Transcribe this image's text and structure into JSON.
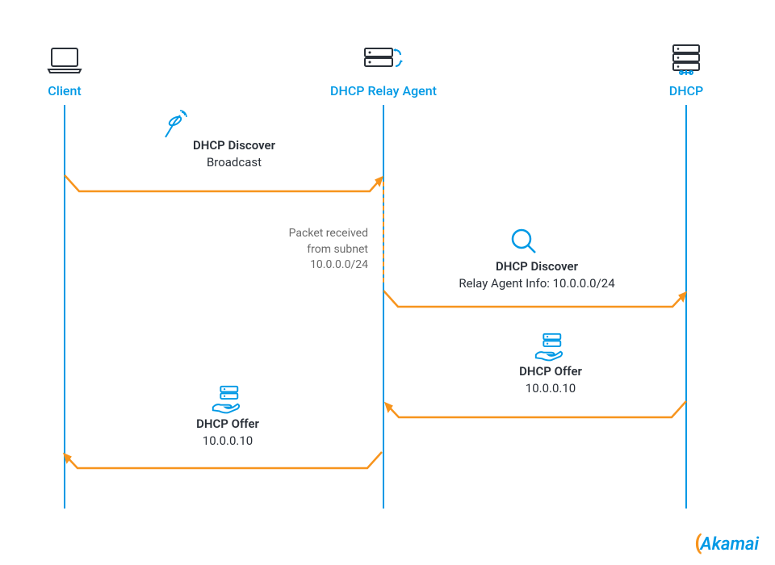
{
  "actors": {
    "client": {
      "label": "Client"
    },
    "relay": {
      "label": "DHCP Relay Agent"
    },
    "dhcp": {
      "label": "DHCP"
    }
  },
  "messages": {
    "m1": {
      "title": "DHCP Discover",
      "subtitle": "Broadcast"
    },
    "m2": {
      "title": "DHCP Discover",
      "subtitle": "Relay Agent Info: 10.0.0.0/24"
    },
    "m3": {
      "title": "DHCP Offer",
      "subtitle": "10.0.0.10"
    },
    "m4": {
      "title": "DHCP Offer",
      "subtitle": "10.0.0.10"
    }
  },
  "note": {
    "line1": "Packet received",
    "line2": "from subnet",
    "line3": "10.0.0.0/24"
  },
  "logo": "Akamai"
}
